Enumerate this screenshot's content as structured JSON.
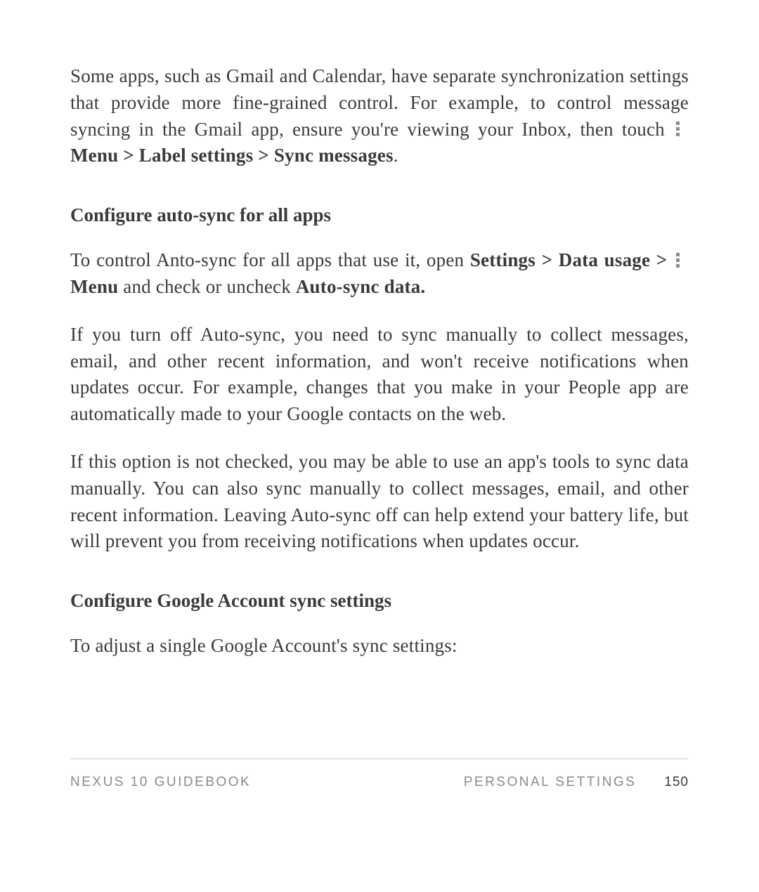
{
  "para1": {
    "t1": "Some apps, such as Gmail and Calendar, have separate synchro­nization settings that provide more fine-grained control. For ex­ample, to control message syncing in the Gmail app, ensure you're viewing your Inbox, then touch ",
    "t2": "Menu > Label settings > Sync messages",
    "t3": "."
  },
  "heading1": "Configure auto-sync for all apps",
  "para2": {
    "t1": "To control Anto-sync for all apps that use it, open ",
    "t2": "Settings > Data usage > ",
    "t3": " Menu",
    "t4": " and check or uncheck ",
    "t5": "Auto-sync data."
  },
  "para3": "If you turn off Auto-sync, you need to sync manually to collect messages, email, and other recent information, and won't receive notifications when updates occur. For example, changes that you make in your People app are automatically made to your Google contacts on the web.",
  "para4": "If this option is not checked, you may be able to use an app's tools to sync data manually. You can also sync manually to collect mes­sages, email, and other recent information. Leaving Auto-sync off can help extend your battery life, but will prevent you from receiv­ing notifications when updates occur.",
  "heading2": "Configure Google Account sync settings",
  "para5": "To adjust a single Google Account's sync settings:",
  "footer": {
    "left": "NEXUS 10 GUIDEBOOK",
    "right": "PERSONAL SETTINGS",
    "page": "150"
  }
}
